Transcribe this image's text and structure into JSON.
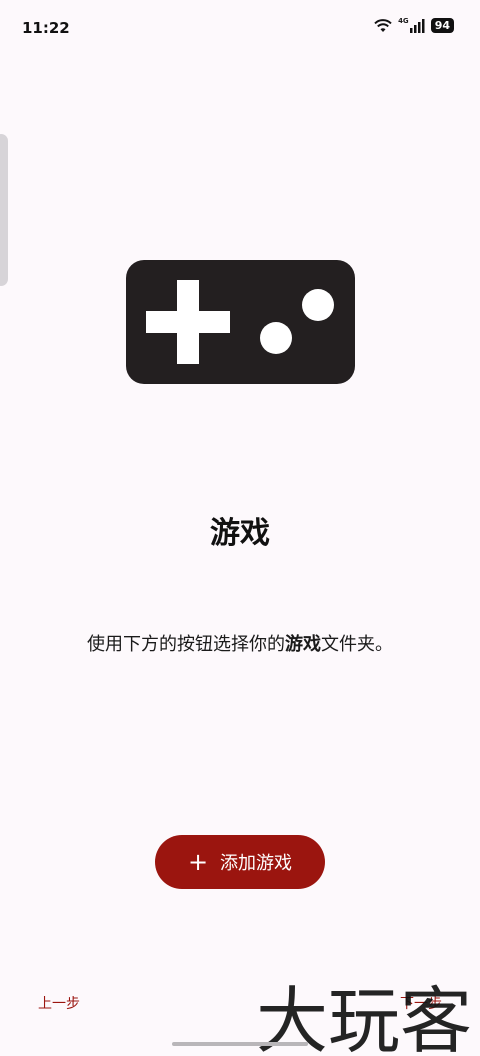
{
  "status_bar": {
    "time": "11:22",
    "network": "4G",
    "battery": "94"
  },
  "onboarding": {
    "title": "游戏",
    "description_before": "使用下方的按钮选择你的",
    "description_bold": "游戏",
    "description_after": "文件夹。",
    "add_button_label": "添加游戏",
    "add_button_icon": "plus-icon",
    "illustration_icon": "gamepad-icon"
  },
  "footer": {
    "prev_label": "上一步",
    "next_label": "下一步"
  },
  "watermark": {
    "text": "大玩客"
  },
  "colors": {
    "accent": "#9b150f",
    "background": "#fdf9fc",
    "gamepad": "#231f20"
  }
}
